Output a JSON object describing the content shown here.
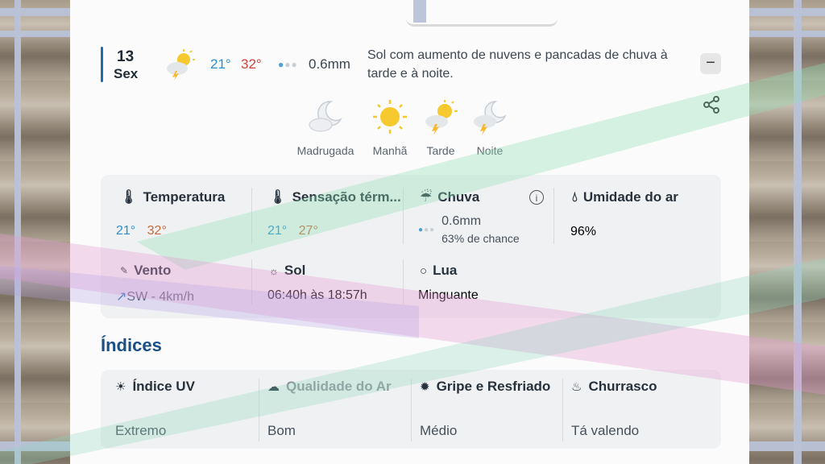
{
  "day": {
    "number": "13",
    "name": "Sex"
  },
  "summary": {
    "temp_min": "21°",
    "temp_max": "32°",
    "precip": "0.6mm",
    "description": "Sol com aumento de nuvens e pancadas de chuva à tarde e à noite.",
    "collapse_label": "−",
    "icon": "sun-cloud-thunder-icon"
  },
  "periods": [
    {
      "label": "Madrugada",
      "icon": "moon-cloud-icon"
    },
    {
      "label": "Manhã",
      "icon": "sun-icon"
    },
    {
      "label": "Tarde",
      "icon": "sun-cloud-thunder-icon"
    },
    {
      "label": "Noite",
      "icon": "moon-cloud-thunder-icon"
    }
  ],
  "details": {
    "temperatura": {
      "label": "Temperatura",
      "min": "21°",
      "max": "32°"
    },
    "sensacao": {
      "label": "Sensação térm...",
      "min": "21°",
      "max": "27°"
    },
    "chuva": {
      "label": "Chuva",
      "amount": "0.6mm",
      "chance": "63% de chance"
    },
    "umidade": {
      "label": "Umidade do ar",
      "value": "96%"
    },
    "vento": {
      "label": "Vento",
      "arrow": "↗",
      "value": "SW - 4km/h"
    },
    "sol": {
      "label": "Sol",
      "value": "06:40h às 18:57h"
    },
    "lua": {
      "label": "Lua",
      "value": "Minguante"
    }
  },
  "indices": {
    "title": "Índices",
    "items": [
      {
        "label": "Índice UV",
        "value": "Extremo"
      },
      {
        "label": "Qualidade do Ar",
        "value": "Bom"
      },
      {
        "label": "Gripe e Resfriado",
        "value": "Médio"
      },
      {
        "label": "Churrasco",
        "value": "Tá valendo"
      }
    ]
  },
  "colors": {
    "min_temp": "#2a8fcf",
    "max_temp": "#d0433a",
    "accent": "#1b6ea8",
    "index_title": "#1a4f86"
  }
}
